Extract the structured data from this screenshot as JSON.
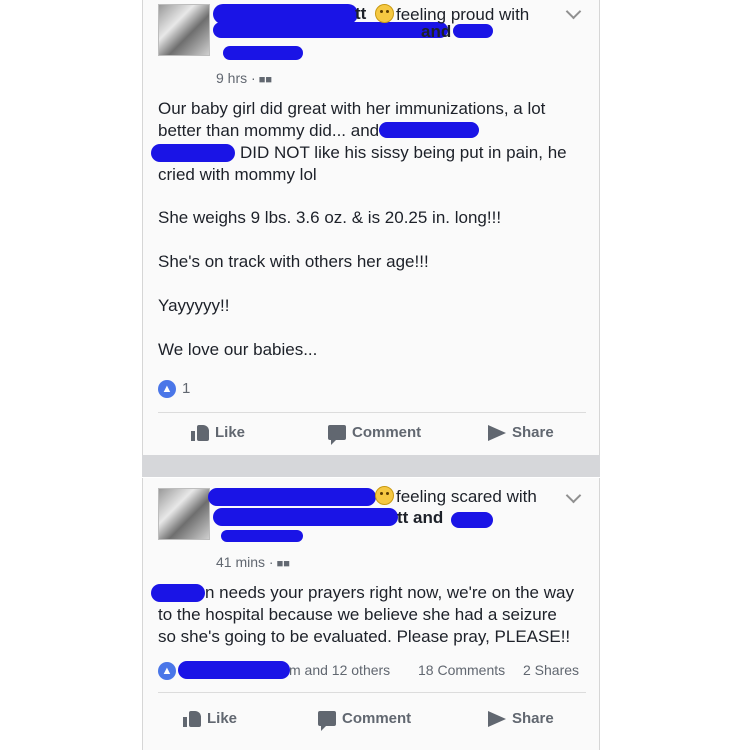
{
  "post1": {
    "header_suffix": "tt",
    "feeling": "feeling proud with",
    "and_text": "and",
    "time": "9 hrs ·",
    "audience_icon": "friends-icon",
    "body_line1": "Our baby girl did great with her immunizations, a lot",
    "body_line2": "better than mommy did... and",
    "body_line3_tail": "DID NOT like his sissy being put in pain, he",
    "body_line4": "cried with mommy lol",
    "para2": "She weighs 9 lbs. 3.6 oz. & is 20.25 in. long!!!",
    "para3": "She's on track with others her age!!!",
    "para4": "Yayyyyy!!",
    "para5": "We love our babies...",
    "like_count": "1",
    "actions": {
      "like": "Like",
      "comment": "Comment",
      "share": "Share"
    }
  },
  "post2": {
    "feeling": "feeling scared with",
    "header_suffix": "tt and",
    "time": "41 mins ·",
    "audience_icon": "friends-icon",
    "body_line1_tail": "n needs your prayers right now, we're on the way",
    "body_line2": "to the hospital because we believe she had a seizure",
    "body_line3": "so she's going to be evaluated.  Please pray, PLEASE!!",
    "reactions_tail": "m and 12 others",
    "comments_count": "18 Comments",
    "shares_count": "2 Shares",
    "actions": {
      "like": "Like",
      "comment": "Comment",
      "share": "Share"
    }
  },
  "colors": {
    "redaction": "#1a14e6",
    "muted": "#616770",
    "text": "#1d2129",
    "like_blue": "#4a76e8"
  }
}
